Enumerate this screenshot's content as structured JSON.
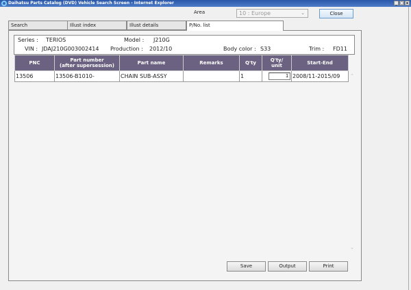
{
  "window": {
    "title": "Daihatsu Parts Catalog (DVD)  Vehicle Search Screen - Internet Explorer",
    "controls": [
      "_",
      "□",
      "x"
    ]
  },
  "area": {
    "label": "Area",
    "selected": "10 : Europe"
  },
  "close_label": "Close",
  "tabs": [
    {
      "label": "Search"
    },
    {
      "label": "Illust index"
    },
    {
      "label": "Illust details"
    },
    {
      "label": "P/No. list"
    }
  ],
  "info": {
    "series_label": "Series :",
    "series": "TERIOS",
    "model_label": "Model :",
    "model": "J210G",
    "vin_label": "VIN :",
    "vin": "JDAJ210G003002414",
    "production_label": "Production :",
    "production": "2012/10",
    "body_color_label": "Body color :",
    "body_color": "S33",
    "trim_label": "Trim :",
    "trim": "FD11"
  },
  "table": {
    "headers": [
      "PNC",
      "Part number\n(after supersession)",
      "Part name",
      "Remarks",
      "Q'ty",
      "Q'ty/\nunit",
      "Start-End"
    ],
    "rows": [
      {
        "pnc": "13506",
        "part_number": "13506-B1010-",
        "part_name": "CHAIN SUB-ASSY",
        "remarks": "",
        "qty": "1",
        "qty_unit": "1",
        "start_end": "2008/11-2015/09"
      }
    ]
  },
  "buttons": {
    "save": "Save",
    "output": "Output",
    "print": "Print"
  },
  "colors": {
    "header": "#6b6180",
    "titlebar": "#2a57a8"
  }
}
